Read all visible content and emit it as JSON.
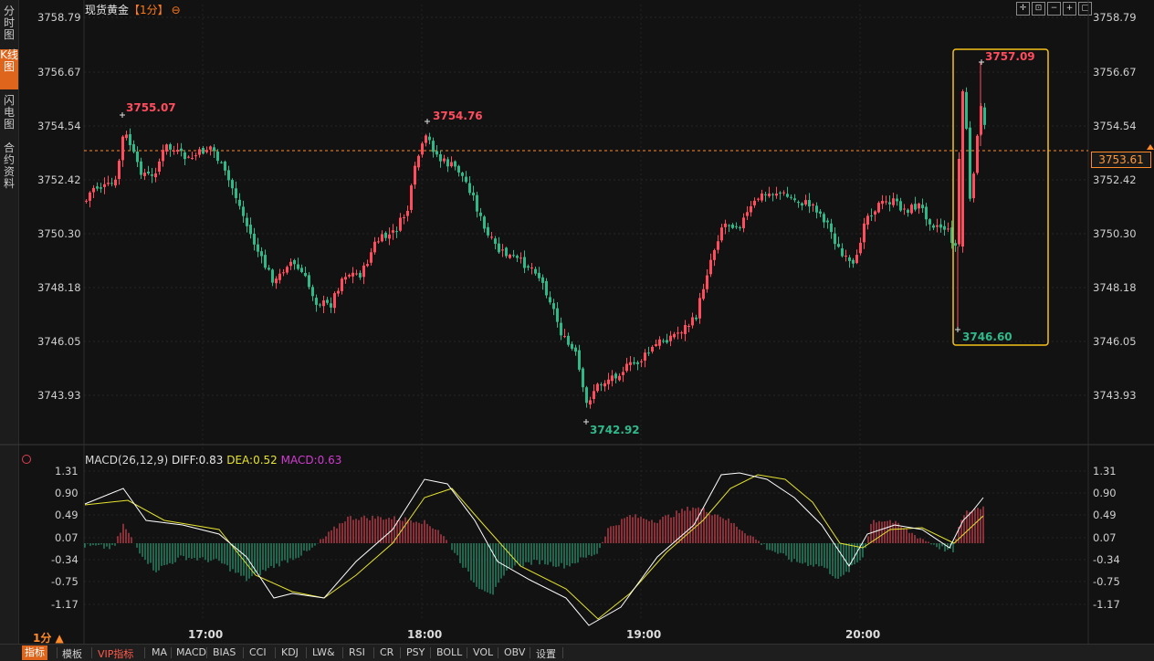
{
  "sidebar": {
    "tabs": [
      {
        "label": "分时图"
      },
      {
        "label": "K线图",
        "active": true
      },
      {
        "label": "闪电图"
      },
      {
        "label": "合约资料"
      }
    ]
  },
  "header": {
    "instrument": "现货黄金",
    "period": "【1分】",
    "toolbar_icons": [
      "crosshair-icon",
      "zoom-fit-icon",
      "zoom-out-icon",
      "zoom-in-icon",
      "restore-icon"
    ]
  },
  "price_panel": {
    "y_ticks": [
      "3758.79",
      "3756.67",
      "3754.54",
      "3752.42",
      "3750.30",
      "3748.18",
      "3746.05",
      "3743.93"
    ],
    "current_price": "3753.61",
    "annotations": {
      "high1": "3755.07",
      "high2": "3754.76",
      "low1": "3742.92",
      "high3": "3757.09",
      "low3": "3746.60"
    }
  },
  "macd_panel": {
    "label": "MACD(26,12,9)",
    "diff": "DIFF:0.83",
    "dea": "DEA:0.52",
    "macd": "MACD:0.63",
    "y_ticks": [
      "1.31",
      "0.90",
      "0.49",
      "0.07",
      "-0.34",
      "-0.75",
      "-1.17"
    ]
  },
  "x_axis": {
    "period_selector": "1分",
    "ticks": [
      "17:00",
      "18:00",
      "19:00",
      "20:00"
    ]
  },
  "bottom_tabs": [
    "指标",
    "模板",
    "VIP指标",
    "MA",
    "MACD",
    "BIAS",
    "CCI",
    "KDJ",
    "LW&",
    "RSI",
    "CR",
    "PSY",
    "BOLL",
    "VOL",
    "OBV",
    "设置"
  ],
  "colors": {
    "up": "#ff4d5e",
    "down": "#2fb98a",
    "dea_line": "#e5e32f",
    "diff_line": "#ffffff",
    "macd_text": "#d03cd0",
    "accent": "#e0651c",
    "highlight_box": "#f5c218"
  }
}
